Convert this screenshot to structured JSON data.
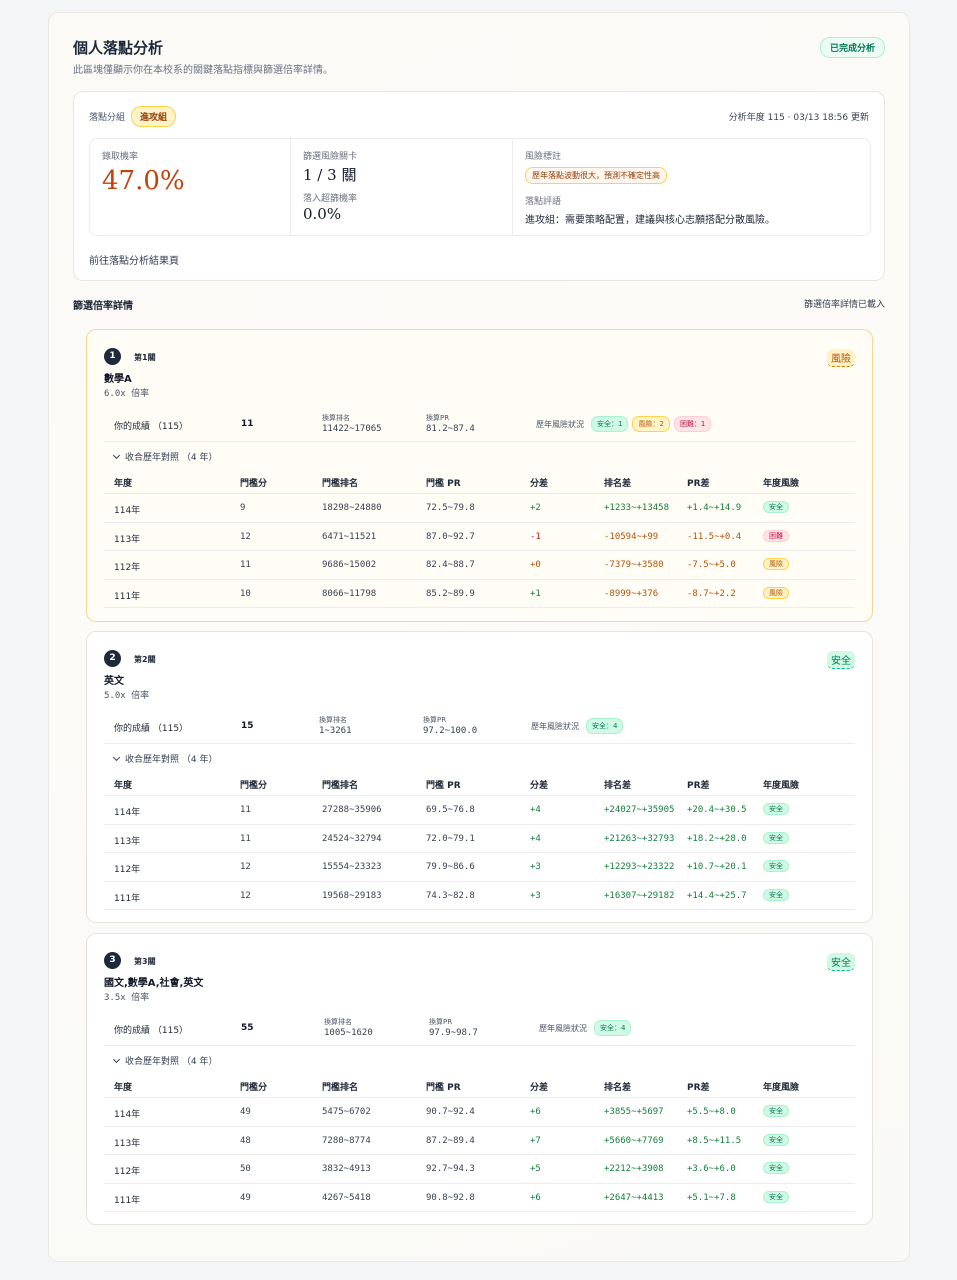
{
  "header": {
    "title": "個人落點分析",
    "subtitle": "此區塊僅顯示你在本校系的關鍵落點指標與篩選倍率詳情。",
    "status_badge": "已完成分析"
  },
  "summary": {
    "group_label": "落點分組",
    "group_badge": "進攻組",
    "updated": "分析年度 115 · 03/13 18:56 更新",
    "admit_label": "錄取機率",
    "admit_value": "47.0%",
    "screen_label": "篩選風險關卡",
    "screen_value": "1 / 3 關",
    "over_label": "落入超篩機率",
    "over_value": "0.0%",
    "risk_label": "風險標註",
    "risk_chip": "歷年落點波動很大，預測不確定性高",
    "comment_label": "落點評語",
    "comment": "進攻組：需要策略配置，建議與核心志願搭配分散風險。",
    "goto_link": "前往落點分析結果頁"
  },
  "section": {
    "title": "篩選倍率詳情",
    "status": "篩選倍率詳情已載入"
  },
  "table_headers": [
    "年度",
    "門檻分",
    "門檻排名",
    "門檻 PR",
    "分差",
    "排名差",
    "PR差",
    "年度風險"
  ],
  "labels": {
    "your_score": "你的成績 （115）",
    "rank_key": "換算排名",
    "pr_key": "換算PR",
    "history": "歷年風險狀況",
    "collapse": "收合歷年對照 （4 年）"
  },
  "stages": [
    {
      "num": "1",
      "stage": "第1關",
      "subject": "數學A",
      "multiplier": "6.0x 倍率",
      "risk": "風險",
      "risk_type": "warn",
      "score": "11",
      "rank": "11422~17065",
      "pr": "81.2~87.4",
      "pills": [
        {
          "text": "安全：1",
          "type": "safe"
        },
        {
          "text": "風險：2",
          "type": "warn"
        },
        {
          "text": "困難：1",
          "type": "hard"
        }
      ],
      "rows": [
        {
          "year": "114年",
          "score": "9",
          "rank": "18298~24880",
          "pr": "72.5~79.8",
          "diff": "+2",
          "diff_c": "g",
          "rdiff": "+1233~+13458",
          "rdiff_c": "g",
          "pdiff": "+1.4~+14.9",
          "pdiff_c": "g",
          "risk": "安全",
          "risk_type": "safe"
        },
        {
          "year": "113年",
          "score": "12",
          "rank": "6471~11521",
          "pr": "87.0~92.7",
          "diff": "-1",
          "diff_c": "r",
          "rdiff": "-10594~+99",
          "rdiff_c": "o",
          "pdiff": "-11.5~+0.4",
          "pdiff_c": "o",
          "risk": "困難",
          "risk_type": "hard"
        },
        {
          "year": "112年",
          "score": "11",
          "rank": "9686~15002",
          "pr": "82.4~88.7",
          "diff": "+0",
          "diff_c": "o",
          "rdiff": "-7379~+3580",
          "rdiff_c": "o",
          "pdiff": "-7.5~+5.0",
          "pdiff_c": "o",
          "risk": "風險",
          "risk_type": "warn"
        },
        {
          "year": "111年",
          "score": "10",
          "rank": "8066~11798",
          "pr": "85.2~89.9",
          "diff": "+1",
          "diff_c": "g",
          "rdiff": "-8999~+376",
          "rdiff_c": "o",
          "pdiff": "-8.7~+2.2",
          "pdiff_c": "o",
          "risk": "風險",
          "risk_type": "warn"
        }
      ]
    },
    {
      "num": "2",
      "stage": "第2關",
      "subject": "英文",
      "multiplier": "5.0x 倍率",
      "risk": "安全",
      "risk_type": "safe",
      "score": "15",
      "rank": "1~3261",
      "pr": "97.2~100.0",
      "pills": [
        {
          "text": "安全：4",
          "type": "safe"
        }
      ],
      "rows": [
        {
          "year": "114年",
          "score": "11",
          "rank": "27288~35906",
          "pr": "69.5~76.8",
          "diff": "+4",
          "diff_c": "g",
          "rdiff": "+24027~+35905",
          "rdiff_c": "g",
          "pdiff": "+20.4~+30.5",
          "pdiff_c": "g",
          "risk": "安全",
          "risk_type": "safe"
        },
        {
          "year": "113年",
          "score": "11",
          "rank": "24524~32794",
          "pr": "72.0~79.1",
          "diff": "+4",
          "diff_c": "g",
          "rdiff": "+21263~+32793",
          "rdiff_c": "g",
          "pdiff": "+18.2~+28.0",
          "pdiff_c": "g",
          "risk": "安全",
          "risk_type": "safe"
        },
        {
          "year": "112年",
          "score": "12",
          "rank": "15554~23323",
          "pr": "79.9~86.6",
          "diff": "+3",
          "diff_c": "g",
          "rdiff": "+12293~+23322",
          "rdiff_c": "g",
          "pdiff": "+10.7~+20.1",
          "pdiff_c": "g",
          "risk": "安全",
          "risk_type": "safe"
        },
        {
          "year": "111年",
          "score": "12",
          "rank": "19568~29183",
          "pr": "74.3~82.8",
          "diff": "+3",
          "diff_c": "g",
          "rdiff": "+16307~+29182",
          "rdiff_c": "g",
          "pdiff": "+14.4~+25.7",
          "pdiff_c": "g",
          "risk": "安全",
          "risk_type": "safe"
        }
      ]
    },
    {
      "num": "3",
      "stage": "第3關",
      "subject": "國文,數學A,社會,英文",
      "multiplier": "3.5x 倍率",
      "risk": "安全",
      "risk_type": "safe",
      "score": "55",
      "rank": "1005~1620",
      "pr": "97.9~98.7",
      "pills": [
        {
          "text": "安全：4",
          "type": "safe"
        }
      ],
      "rows": [
        {
          "year": "114年",
          "score": "49",
          "rank": "5475~6702",
          "pr": "90.7~92.4",
          "diff": "+6",
          "diff_c": "g",
          "rdiff": "+3855~+5697",
          "rdiff_c": "g",
          "pdiff": "+5.5~+8.0",
          "pdiff_c": "g",
          "risk": "安全",
          "risk_type": "safe"
        },
        {
          "year": "113年",
          "score": "48",
          "rank": "7280~8774",
          "pr": "87.2~89.4",
          "diff": "+7",
          "diff_c": "g",
          "rdiff": "+5660~+7769",
          "rdiff_c": "g",
          "pdiff": "+8.5~+11.5",
          "pdiff_c": "g",
          "risk": "安全",
          "risk_type": "safe"
        },
        {
          "year": "112年",
          "score": "50",
          "rank": "3832~4913",
          "pr": "92.7~94.3",
          "diff": "+5",
          "diff_c": "g",
          "rdiff": "+2212~+3908",
          "rdiff_c": "g",
          "pdiff": "+3.6~+6.0",
          "pdiff_c": "g",
          "risk": "安全",
          "risk_type": "safe"
        },
        {
          "year": "111年",
          "score": "49",
          "rank": "4267~5418",
          "pr": "90.8~92.8",
          "diff": "+6",
          "diff_c": "g",
          "rdiff": "+2647~+4413",
          "rdiff_c": "g",
          "pdiff": "+5.1~+7.8",
          "pdiff_c": "g",
          "risk": "安全",
          "risk_type": "safe"
        }
      ]
    }
  ]
}
